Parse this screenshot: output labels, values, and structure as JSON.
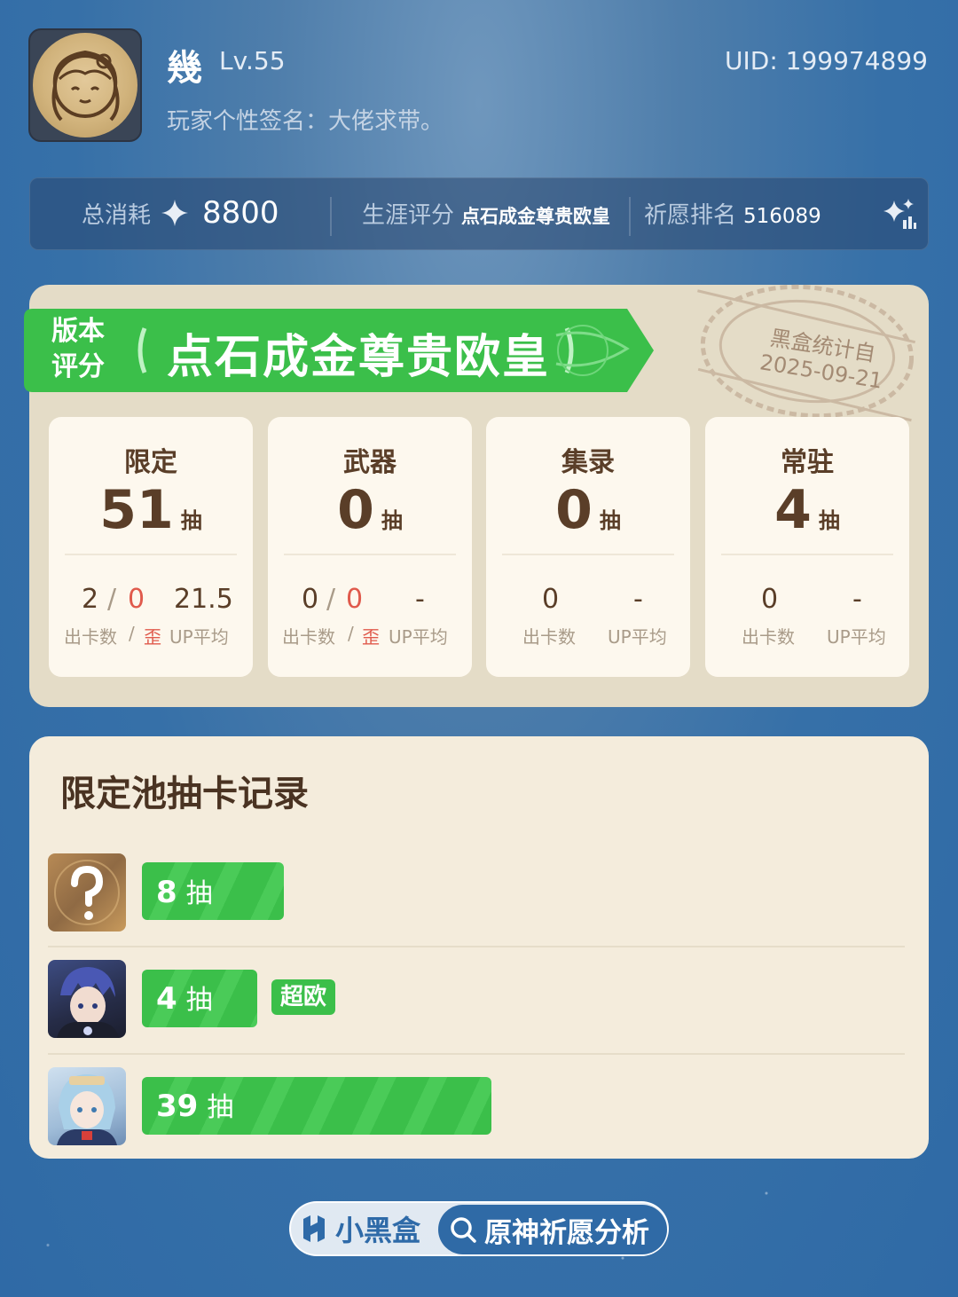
{
  "profile": {
    "name": "幾",
    "level": "Lv.55",
    "signature": "玩家个性签名：大佬求带。",
    "uid": "UID: 199974899"
  },
  "summary": {
    "spend_label": "总消耗",
    "spend_value": "8800",
    "career_label": "生涯评分",
    "career_value": "点石成金尊贵欧皇",
    "rank_label": "祈愿排名",
    "rank_value": "516089",
    "icon": "sparkle-chart-icon"
  },
  "version": {
    "label_line1": "版本",
    "label_line2": "评分",
    "title": "点石成金尊贵欧皇",
    "stamp_line1": "黑盒统计自",
    "stamp_line2": "2025-09-21"
  },
  "pools": [
    {
      "name": "限定",
      "count": "51",
      "unit": "抽",
      "cards": "2",
      "slash": "/",
      "off": "0",
      "avg": "21.5",
      "l_cards": "出卡数",
      "l_slash": "/",
      "l_off": "歪",
      "l_avg": "UP平均"
    },
    {
      "name": "武器",
      "count": "0",
      "unit": "抽",
      "cards": "0",
      "slash": "/",
      "off": "0",
      "avg": "-",
      "l_cards": "出卡数",
      "l_slash": "/",
      "l_off": "歪",
      "l_avg": "UP平均"
    },
    {
      "name": "集录",
      "count": "0",
      "unit": "抽",
      "cards": "0",
      "avg": "-",
      "l_cards": "出卡数",
      "l_avg": "UP平均"
    },
    {
      "name": "常驻",
      "count": "4",
      "unit": "抽",
      "cards": "0",
      "avg": "-",
      "l_cards": "出卡数",
      "l_avg": "UP平均"
    }
  ],
  "records": {
    "title": "限定池抽卡记录",
    "items": [
      {
        "pulls": "8",
        "unit": "抽",
        "badge": ""
      },
      {
        "pulls": "4",
        "unit": "抽",
        "badge": "超欧"
      },
      {
        "pulls": "39",
        "unit": "抽",
        "badge": ""
      }
    ]
  },
  "footer": {
    "brand": "小黑盒",
    "feature": "原神祈愿分析"
  },
  "colors": {
    "accent_green": "#3bbf4a",
    "card_bg": "#e4dcc7",
    "text_brown": "#5a3e28",
    "loss_red": "#e05a4c"
  }
}
